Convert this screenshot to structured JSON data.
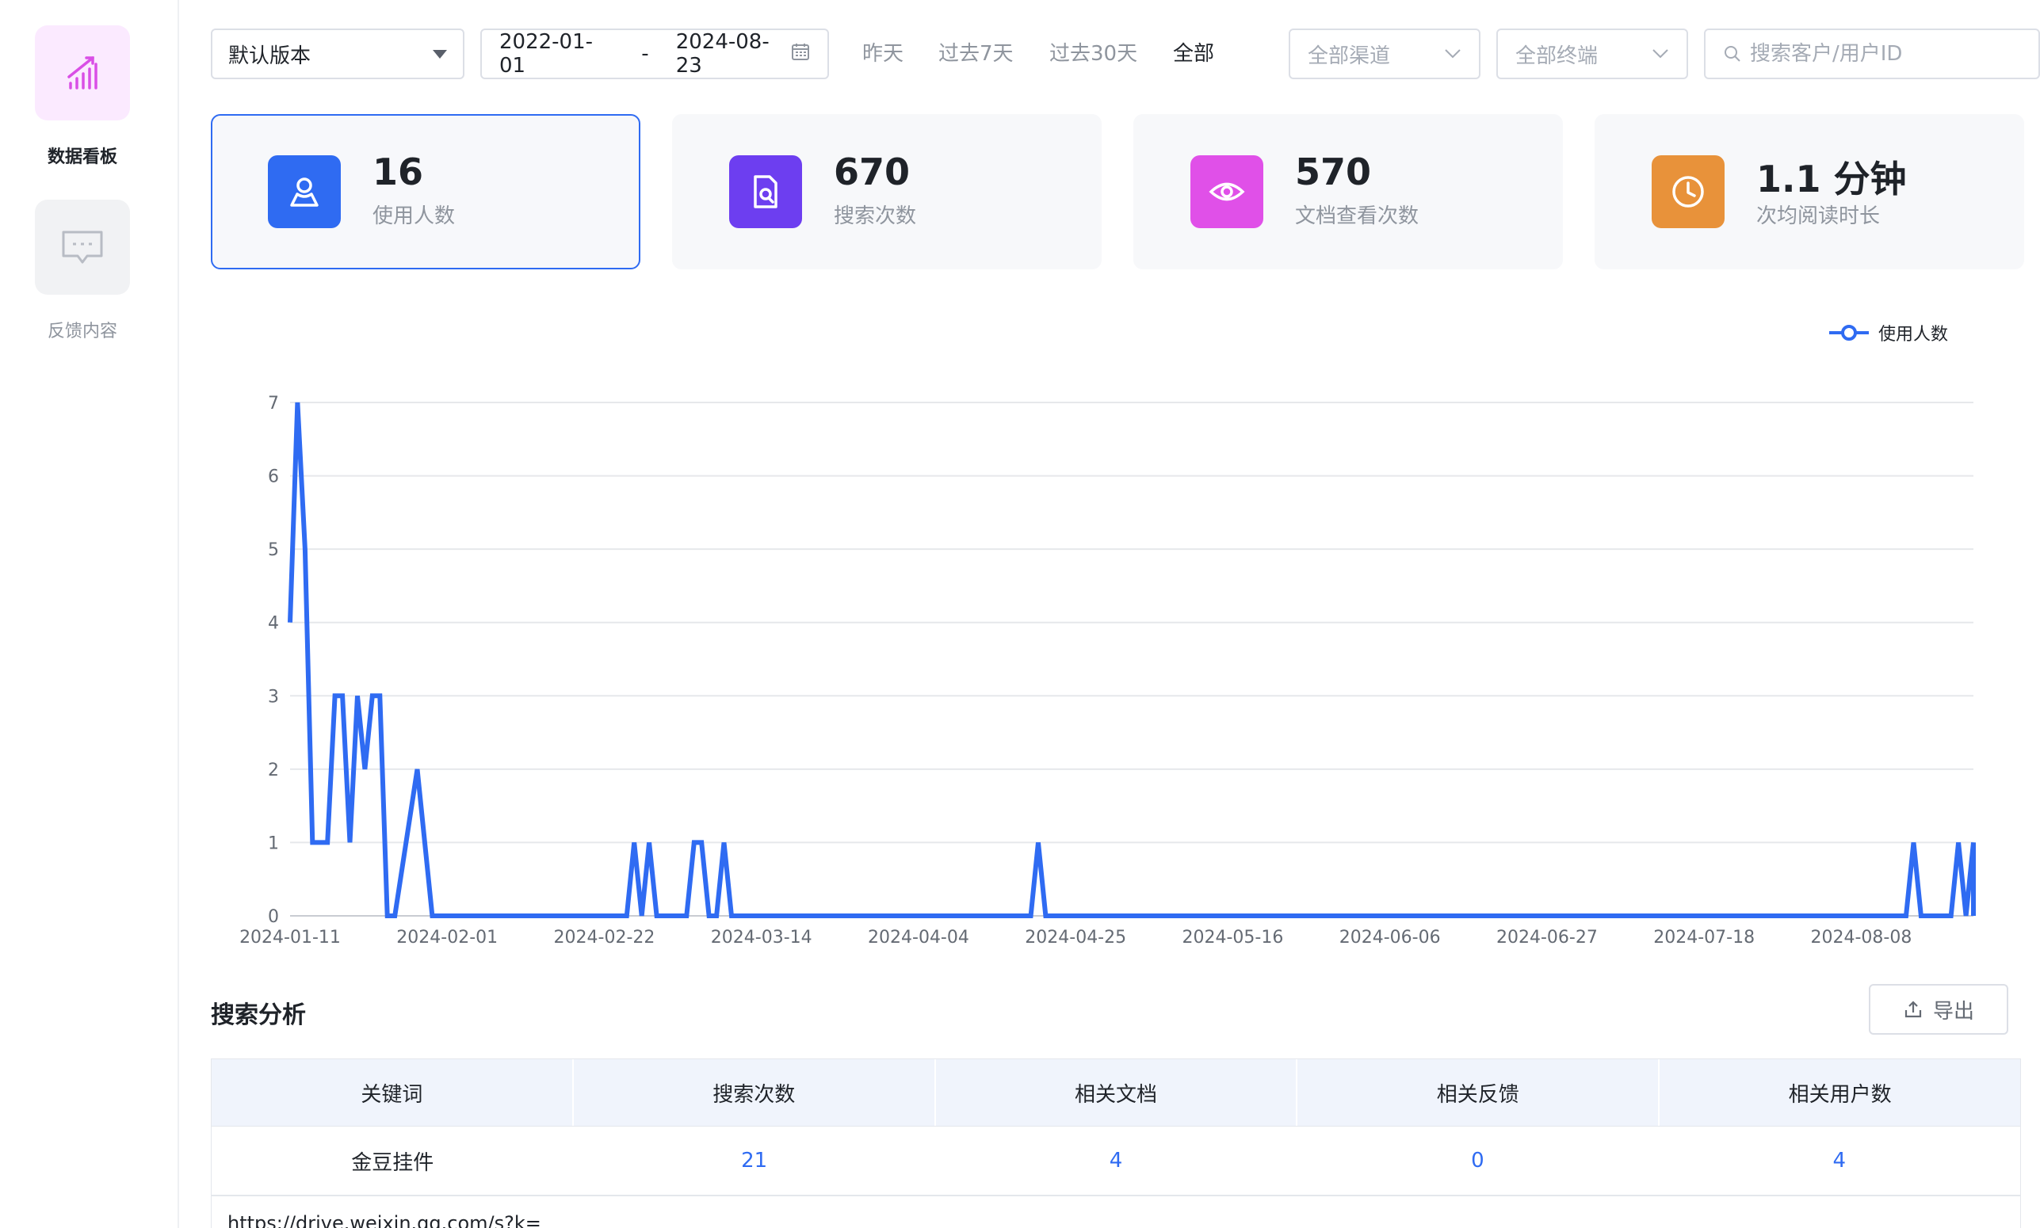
{
  "sidebar": {
    "items": [
      {
        "label": "数据看板",
        "icon": "bar-chart-icon",
        "active": true
      },
      {
        "label": "反馈内容",
        "icon": "message-icon",
        "active": false
      }
    ]
  },
  "toolbar": {
    "version_select": "默认版本",
    "date_start": "2022-01-01",
    "date_sep": "-",
    "date_end": "2024-08-23",
    "quick_ranges": [
      "昨天",
      "过去7天",
      "过去30天",
      "全部"
    ],
    "quick_active": "全部",
    "channel_placeholder": "全部渠道",
    "terminal_placeholder": "全部终端",
    "search_placeholder": "搜索客户/用户ID"
  },
  "stats": [
    {
      "value": "16",
      "label": "使用人数",
      "icon": "user-icon",
      "color": "#2f6bf2"
    },
    {
      "value": "670",
      "label": "搜索次数",
      "icon": "doc-search-icon",
      "color": "#6d3ef0"
    },
    {
      "value": "570",
      "label": "文档查看次数",
      "icon": "eye-icon",
      "color": "#e050e8"
    },
    {
      "value": "1.1 分钟",
      "label": "次均阅读时长",
      "icon": "clock-icon",
      "color": "#e8923a"
    }
  ],
  "chart_data": {
    "type": "line",
    "title": "",
    "xlabel": "",
    "ylabel": "",
    "ylim": [
      0,
      7
    ],
    "yticks": [
      "0",
      "1",
      "2",
      "3",
      "4",
      "5",
      "6",
      "7"
    ],
    "x_tick_labels": [
      "2024-01-11",
      "2024-02-01",
      "2024-02-22",
      "2024-03-14",
      "2024-04-04",
      "2024-04-25",
      "2024-05-16",
      "2024-06-06",
      "2024-06-27",
      "2024-07-18",
      "2024-08-08"
    ],
    "x_start": "2024-01-11",
    "x_end": "2024-08-23",
    "grid": true,
    "legend": "top-right",
    "series": [
      {
        "name": "使用人数",
        "color": "#2f6bf2",
        "points": [
          [
            "2024-01-11",
            4
          ],
          [
            "2024-01-12",
            7
          ],
          [
            "2024-01-13",
            5
          ],
          [
            "2024-01-14",
            1
          ],
          [
            "2024-01-15",
            1
          ],
          [
            "2024-01-16",
            1
          ],
          [
            "2024-01-17",
            3
          ],
          [
            "2024-01-18",
            3
          ],
          [
            "2024-01-19",
            1
          ],
          [
            "2024-01-20",
            3
          ],
          [
            "2024-01-21",
            2
          ],
          [
            "2024-01-22",
            3
          ],
          [
            "2024-01-23",
            3
          ],
          [
            "2024-01-24",
            0
          ],
          [
            "2024-01-25",
            0
          ],
          [
            "2024-01-28",
            2
          ],
          [
            "2024-01-30",
            0
          ],
          [
            "2024-02-25",
            0
          ],
          [
            "2024-02-26",
            1
          ],
          [
            "2024-02-27",
            0
          ],
          [
            "2024-02-28",
            1
          ],
          [
            "2024-02-29",
            0
          ],
          [
            "2024-03-04",
            0
          ],
          [
            "2024-03-05",
            1
          ],
          [
            "2024-03-06",
            1
          ],
          [
            "2024-03-07",
            0
          ],
          [
            "2024-03-08",
            0
          ],
          [
            "2024-03-09",
            1
          ],
          [
            "2024-03-10",
            0
          ],
          [
            "2024-04-19",
            0
          ],
          [
            "2024-04-20",
            1
          ],
          [
            "2024-04-21",
            0
          ],
          [
            "2024-08-14",
            0
          ],
          [
            "2024-08-15",
            1
          ],
          [
            "2024-08-16",
            0
          ],
          [
            "2024-08-20",
            0
          ],
          [
            "2024-08-21",
            1
          ],
          [
            "2024-08-22",
            0
          ],
          [
            "2024-08-23",
            1
          ],
          [
            "2024-08-23",
            0
          ]
        ]
      }
    ]
  },
  "section": {
    "title": "搜索分析",
    "export_label": "导出"
  },
  "table": {
    "headers": [
      "关键词",
      "搜索次数",
      "相关文档",
      "相关反馈",
      "相关用户数"
    ],
    "rows": [
      {
        "keyword": "金豆挂件",
        "searches": "21",
        "docs": "4",
        "feedback": "0",
        "users": "4"
      }
    ],
    "partial_row_text": "https://drive.weixin.qq.com/s?k="
  }
}
